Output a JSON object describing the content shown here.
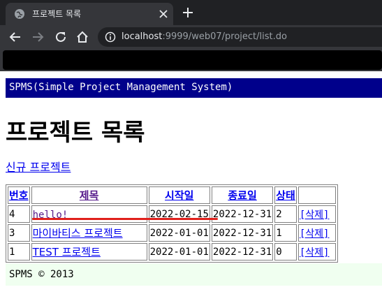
{
  "browser": {
    "tab_title": "프로젝트 목록",
    "url_host": "localhost",
    "url_path": ":9999/web07/project/list.do"
  },
  "page": {
    "header": "SPMS(Simple Project Management System)",
    "title": "프로젝트 목록",
    "new_project_link": "신규 프로젝트",
    "columns": [
      "번호",
      "제목",
      "시작일",
      "종료일",
      "상태",
      ""
    ],
    "rows": [
      {
        "no": "4",
        "title": "hello!",
        "start": "2022-02-15",
        "end": "2022-12-31",
        "state": "2",
        "action": "[삭제]"
      },
      {
        "no": "3",
        "title": "마이바티스 프로젝트",
        "start": "2022-01-01",
        "end": "2022-12-31",
        "state": "1",
        "action": "[삭제]"
      },
      {
        "no": "1",
        "title": "TEST 프로젝트",
        "start": "2022-01-01",
        "end": "2022-12-31",
        "state": "0",
        "action": "[삭제]"
      }
    ],
    "footer": "SPMS © 2013"
  },
  "colors": {
    "header_bg": "#00008b",
    "footer_bg": "#f0fff0",
    "annotation": "#e0201c"
  }
}
